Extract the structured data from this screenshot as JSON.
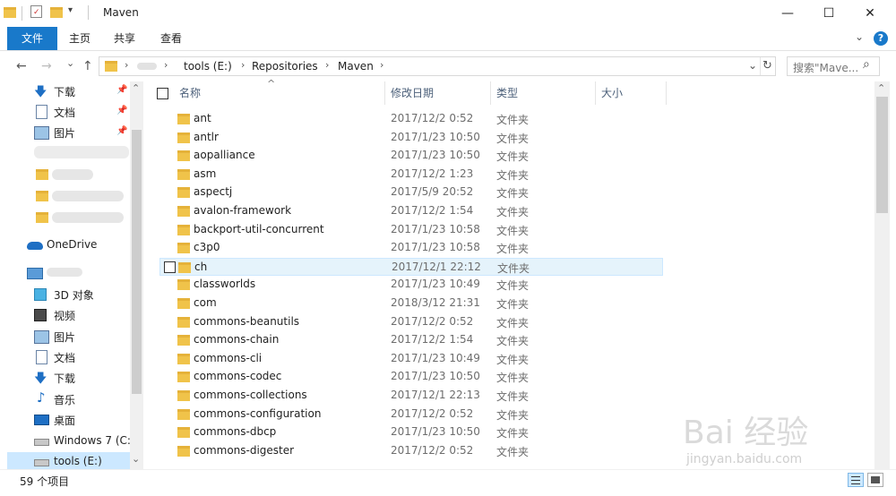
{
  "window": {
    "title": "Maven",
    "minimize_glyph": "—",
    "maximize_glyph": "☐",
    "close_glyph": "✕"
  },
  "ribbon": {
    "tabs": [
      {
        "label": "文件"
      },
      {
        "label": "主页"
      },
      {
        "label": "共享"
      },
      {
        "label": "查看"
      }
    ],
    "expand_glyph": "⌄",
    "help_glyph": "?"
  },
  "nav": {
    "back_glyph": "←",
    "forward_glyph": "→",
    "recent_glyph": "⌄",
    "up_glyph": "↑",
    "refresh_glyph": "↻",
    "dropdown_glyph": "⌄"
  },
  "address": {
    "crumbs": [
      "tools (E:)",
      "Repositories",
      "Maven"
    ],
    "separator": "›"
  },
  "search": {
    "placeholder": "搜索\"Mave...",
    "icon_glyph": "⌕"
  },
  "sidebar": {
    "items": [
      {
        "label": "下载",
        "icon": "download-arrow-icon",
        "pinned": true
      },
      {
        "label": "文档",
        "icon": "document-icon",
        "pinned": true
      },
      {
        "label": "图片",
        "icon": "picture-icon",
        "pinned": true
      },
      {
        "label": "OneDrive",
        "icon": "cloud-icon"
      },
      {
        "label": "3D 对象",
        "icon": "cube-icon"
      },
      {
        "label": "视频",
        "icon": "film-icon"
      },
      {
        "label": "图片",
        "icon": "picture-icon"
      },
      {
        "label": "文档",
        "icon": "document-icon"
      },
      {
        "label": "下载",
        "icon": "download-arrow-icon"
      },
      {
        "label": "音乐",
        "icon": "music-note-icon"
      },
      {
        "label": "桌面",
        "icon": "desktop-icon"
      },
      {
        "label": "Windows 7 (C:)",
        "icon": "drive-icon"
      },
      {
        "label": "tools (E:)",
        "icon": "drive-icon"
      }
    ],
    "pin_glyph": "📌",
    "scroll_up": "⌃",
    "scroll_down": "⌄"
  },
  "columns": {
    "name": "名称",
    "modified": "修改日期",
    "type": "类型",
    "size": "大小",
    "sort_glyph": "^"
  },
  "files": [
    {
      "name": "ant",
      "date": "2017/12/2 0:52",
      "type": "文件夹"
    },
    {
      "name": "antlr",
      "date": "2017/1/23 10:50",
      "type": "文件夹"
    },
    {
      "name": "aopalliance",
      "date": "2017/1/23 10:50",
      "type": "文件夹"
    },
    {
      "name": "asm",
      "date": "2017/12/2 1:23",
      "type": "文件夹"
    },
    {
      "name": "aspectj",
      "date": "2017/5/9 20:52",
      "type": "文件夹"
    },
    {
      "name": "avalon-framework",
      "date": "2017/12/2 1:54",
      "type": "文件夹"
    },
    {
      "name": "backport-util-concurrent",
      "date": "2017/1/23 10:58",
      "type": "文件夹"
    },
    {
      "name": "c3p0",
      "date": "2017/1/23 10:58",
      "type": "文件夹"
    },
    {
      "name": "ch",
      "date": "2017/12/1 22:12",
      "type": "文件夹",
      "hover": true
    },
    {
      "name": "classworlds",
      "date": "2017/1/23 10:49",
      "type": "文件夹"
    },
    {
      "name": "com",
      "date": "2018/3/12 21:31",
      "type": "文件夹"
    },
    {
      "name": "commons-beanutils",
      "date": "2017/12/2 0:52",
      "type": "文件夹"
    },
    {
      "name": "commons-chain",
      "date": "2017/12/2 1:54",
      "type": "文件夹"
    },
    {
      "name": "commons-cli",
      "date": "2017/1/23 10:49",
      "type": "文件夹"
    },
    {
      "name": "commons-codec",
      "date": "2017/1/23 10:50",
      "type": "文件夹"
    },
    {
      "name": "commons-collections",
      "date": "2017/12/1 22:13",
      "type": "文件夹"
    },
    {
      "name": "commons-configuration",
      "date": "2017/12/2 0:52",
      "type": "文件夹"
    },
    {
      "name": "commons-dbcp",
      "date": "2017/1/23 10:50",
      "type": "文件夹"
    },
    {
      "name": "commons-digester",
      "date": "2017/12/2 0:52",
      "type": "文件夹"
    }
  ],
  "status": {
    "item_count": "59 个项目"
  },
  "watermark": {
    "brand": "Bai 经验",
    "url": "jingyan.baidu.com"
  },
  "colors": {
    "accent": "#1979ca",
    "folder": "#f0c34a",
    "hover": "#e5f3fb"
  }
}
